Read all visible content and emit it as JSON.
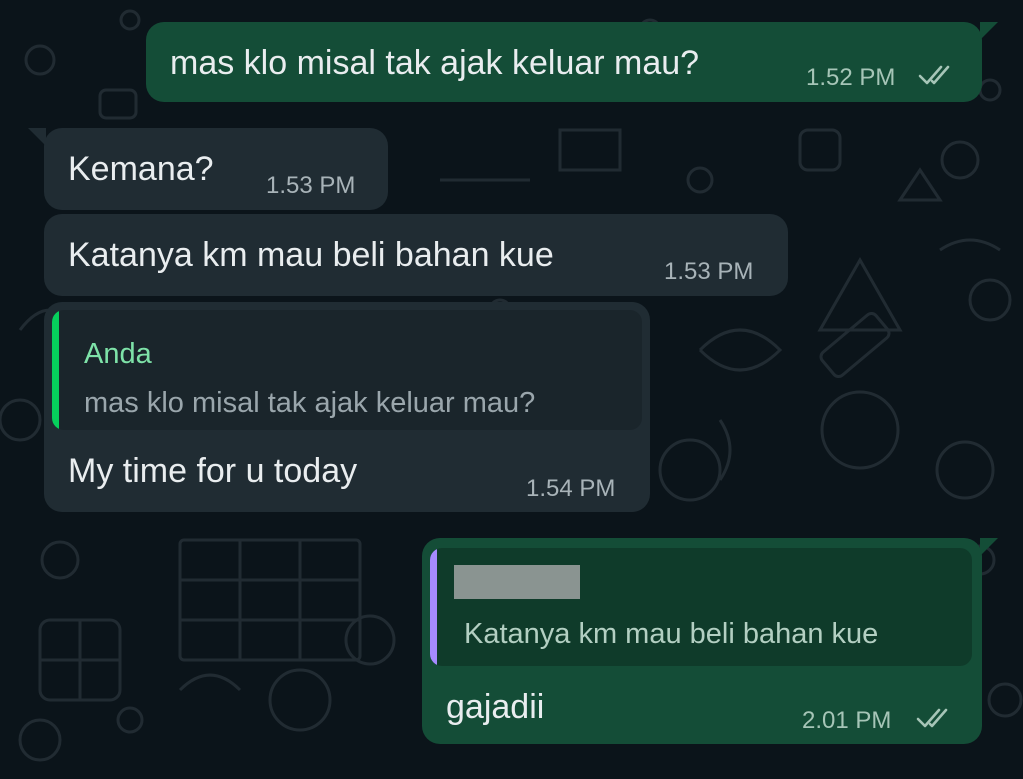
{
  "colors": {
    "background": "#0b141a",
    "outgoing_bubble": "#144d37",
    "incoming_bubble": "#202c33",
    "quote_name_green": "#7ee2a8",
    "quote_bar_green": "#06cf5c",
    "quote_bar_purple": "#a68aff",
    "read_ticks": "#a6c5b7"
  },
  "icons": {
    "read_receipt": "double-check-icon"
  },
  "messages": [
    {
      "direction": "outgoing",
      "text": "mas klo misal tak ajak keluar mau?",
      "time": "1.52 PM",
      "status": "read"
    },
    {
      "direction": "incoming",
      "text": "Kemana?",
      "time": "1.53 PM"
    },
    {
      "direction": "incoming",
      "text": "Katanya km mau beli bahan kue",
      "time": "1.53 PM"
    },
    {
      "direction": "incoming",
      "reply_to": {
        "sender": "Anda",
        "text": "mas klo misal tak ajak keluar mau?"
      },
      "text": "My time for u today",
      "time": "1.54 PM"
    },
    {
      "direction": "outgoing",
      "reply_to": {
        "sender_redacted": true,
        "text": "Katanya km mau beli bahan kue"
      },
      "text": "gajadii",
      "time": "2.01 PM",
      "status": "read"
    }
  ]
}
